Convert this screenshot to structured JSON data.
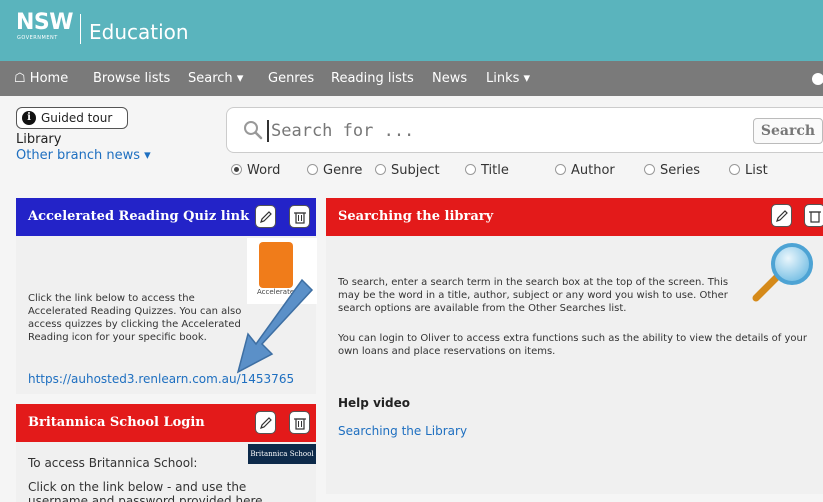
{
  "header": {
    "logo_nsw": "NSW",
    "logo_gov": "GOVERNMENT",
    "logo_edu": "Education"
  },
  "nav": {
    "home": "Home",
    "browse": "Browse lists",
    "search": "Search",
    "genres": "Genres",
    "reading_lists": "Reading lists",
    "news": "News",
    "links": "Links"
  },
  "tour": {
    "label": "Guided tour"
  },
  "library": {
    "label": "Library",
    "branch_news": "Other branch news"
  },
  "search": {
    "placeholder": "Search for ...",
    "button": "Search",
    "options": [
      "Word",
      "Genre",
      "Subject",
      "Title",
      "Author",
      "Series",
      "List"
    ],
    "selected": "Word"
  },
  "panels": {
    "accelerated": {
      "title": "Accelerated Reading Quiz link",
      "body": "Click the link below to access the Accelerated Reading Quizzes. You can also access quizzes by clicking the Accelerated Reading icon for your specific book.",
      "link": "https://auhosted3.renlearn.com.au/1453765",
      "logo_text": "Accelerated"
    },
    "britannica": {
      "title": "Britannica School Login",
      "intro": "To access Britannica School:",
      "step": "Click on the link below - and use the username and password provided here",
      "logo_text": "Britannica School"
    },
    "searching": {
      "title": "Searching the library",
      "para1": "To search, enter a search term in the search box at the top of the screen.  This may be the word in a title, author, subject or any word you wish to use.  Other search options are available from the Other Searches list.",
      "para2": "You can login to Oliver to access extra functions such as the ability to view the details of your own loans and place reservations on items.",
      "help_title": "Help video",
      "help_link": "Searching the Library"
    }
  },
  "colors": {
    "header": "#5ab4bd",
    "nav": "#7a7a7a",
    "blue_panel": "#2323c8",
    "red_panel": "#e31a1a",
    "link": "#1e6fc0"
  }
}
